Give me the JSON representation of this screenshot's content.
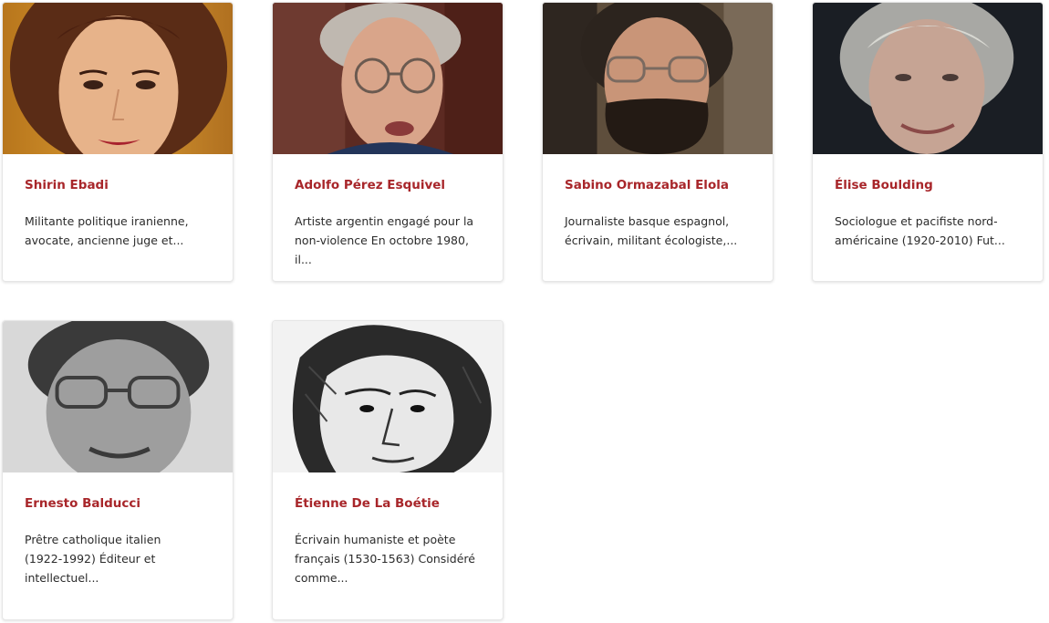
{
  "people": [
    {
      "name": "Shirin Ebadi",
      "desc_line1": "Militante politique iranienne,",
      "desc_line2": "avocate, ancienne juge et...",
      "desc_line3": ""
    },
    {
      "name": "Adolfo Pérez Esquivel",
      "desc_line1": "Artiste argentin engagé pour la",
      "desc_line2": "non-violence En octobre 1980, il...",
      "desc_line3": ""
    },
    {
      "name": "Sabino Ormazabal Elola",
      "desc_line1": "Journaliste basque espagnol,",
      "desc_line2": "écrivain, militant écologiste,...",
      "desc_line3": ""
    },
    {
      "name": "Élise Boulding",
      "desc_line1": "Sociologue et pacifiste nord-",
      "desc_line2": "américaine (1920-2010) Fut...",
      "desc_line3": ""
    },
    {
      "name": "Ernesto Balducci",
      "desc_line1": "Prêtre catholique italien",
      "desc_line2": "(1922-1992) Éditeur et",
      "desc_line3": "intellectuel..."
    },
    {
      "name": "Étienne De La Boétie",
      "desc_line1": "Écrivain humaniste et poète",
      "desc_line2": "français (1530-1563) Considéré",
      "desc_line3": "comme..."
    }
  ],
  "colors": {
    "name": "#a8262a",
    "text": "#2b2b2b"
  }
}
